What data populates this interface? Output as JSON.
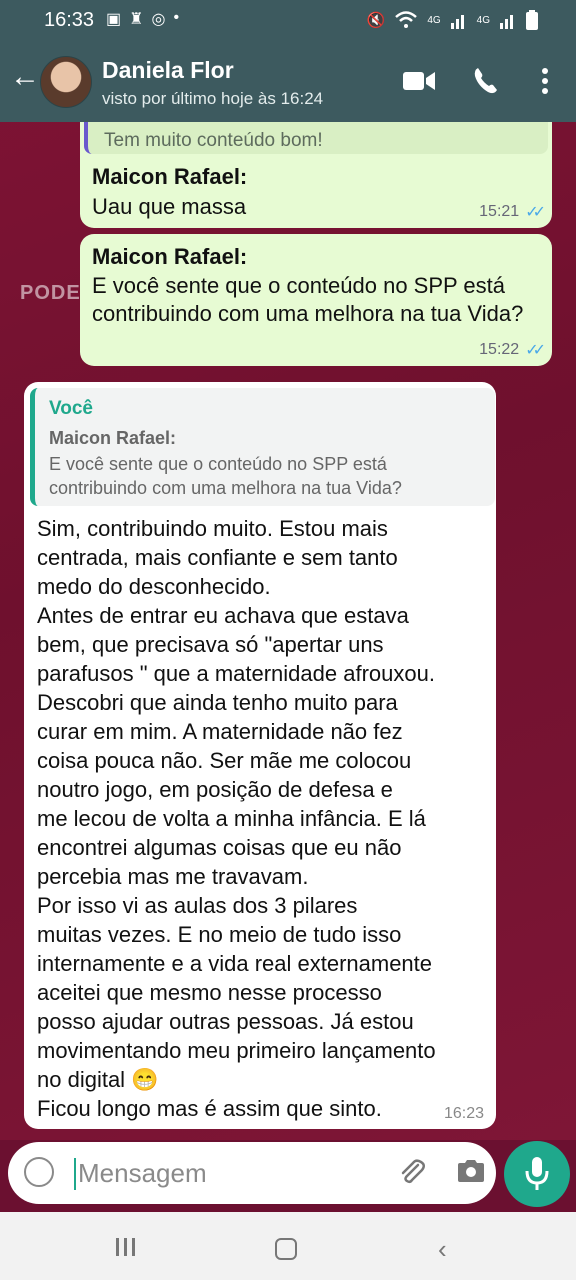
{
  "status_bar": {
    "time": "16:33",
    "signal_labels": [
      "4G",
      "4G"
    ]
  },
  "header": {
    "contact_name": "Daniela Flor",
    "last_seen": "visto por último hoje às 16:24"
  },
  "watermark": "PODE",
  "messages": [
    {
      "quoted_text": "Tem muito conteúdo bom!",
      "sender": "Maicon Rafael:",
      "text": "Uau que massa",
      "time": "15:21"
    },
    {
      "sender": "Maicon Rafael:",
      "text": "E você sente que o conteúdo no SPP está contribuindo com uma melhora na tua Vida?",
      "time": "15:22"
    },
    {
      "quote_author": "Você",
      "quote_sender": "Maicon Rafael:",
      "quote_text": "E você sente que o conteúdo no SPP está contribuindo com uma melhora na tua Vida?",
      "text": "Sim, contribuindo muito. Estou mais\ncentrada, mais confiante e sem tanto\nmedo do desconhecido.\nAntes de entrar eu achava que estava\nbem, que precisava só \"apertar uns\nparafusos \" que a maternidade afrouxou.\nDescobri que ainda tenho muito para\ncurar em mim. A maternidade não fez\ncoisa pouca não. Ser mãe me colocou\nnoutro jogo, em posição de defesa e\nme lecou de volta a minha infância. E lá\nencontrei algumas coisas que eu não\npercebia mas me travavam.\nPor isso vi as aulas dos 3 pilares\nmuitas vezes. E no meio de tudo isso\ninternamente e a vida real externamente\naceitei que mesmo nesse processo\nposso ajudar outras pessoas. Já estou\nmovimentando meu primeiro lançamento\nno digital 😁\nFicou longo mas é assim que sinto.",
      "time": "16:23"
    }
  ],
  "composer": {
    "placeholder": "Mensagem"
  },
  "colors": {
    "header_bg": "#3d5a5f",
    "outgoing_bubble": "#e7fbd3",
    "accent": "#1fa88c",
    "read_ticks": "#4aa8e8"
  }
}
